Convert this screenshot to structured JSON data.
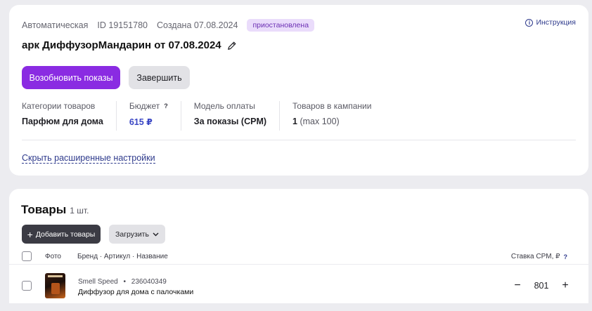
{
  "campaign": {
    "type": "Автоматическая",
    "id": "ID 19151780",
    "created": "Создана 07.08.2024",
    "status": "приостановлена",
    "title": "арк ДиффузорМандарин от 07.08.2024",
    "instruction_label": "Инструкция",
    "resume_label": "Возобновить показы",
    "finish_label": "Завершить",
    "stats": [
      {
        "label": "Категории товаров",
        "value": "Парфюм для дома"
      },
      {
        "label": "Бюджет",
        "value": "615 ₽",
        "has_help": true
      },
      {
        "label": "Модель оплаты",
        "value": "За показы (CPM)"
      },
      {
        "label": "Товаров в кампании",
        "value": "1",
        "extra": "(max 100)"
      }
    ],
    "hide_settings_label": "Скрыть расширенные настройки"
  },
  "goods": {
    "title": "Товары",
    "count": "1 шт.",
    "add_label": "Добавить товары",
    "load_label": "Загрузить",
    "columns": {
      "photo": "Фото",
      "brand": "Бренд · Артикул · Название",
      "rate": "Ставка CPM, ₽"
    },
    "rows": [
      {
        "brand": "Smell Speed",
        "sep": "•",
        "article": "236040349",
        "name": "Диффузор для дома с палочками",
        "rate": "801"
      }
    ]
  },
  "icons": {
    "info": "info-icon",
    "edit": "pencil-icon",
    "help": "question-icon",
    "plus": "plus-icon",
    "chevron": "chevron-down-icon"
  },
  "colors": {
    "accent": "#8a2be2",
    "badge_bg": "#eadcfb",
    "link": "#2e3a8c",
    "budget": "#3a46c4"
  }
}
